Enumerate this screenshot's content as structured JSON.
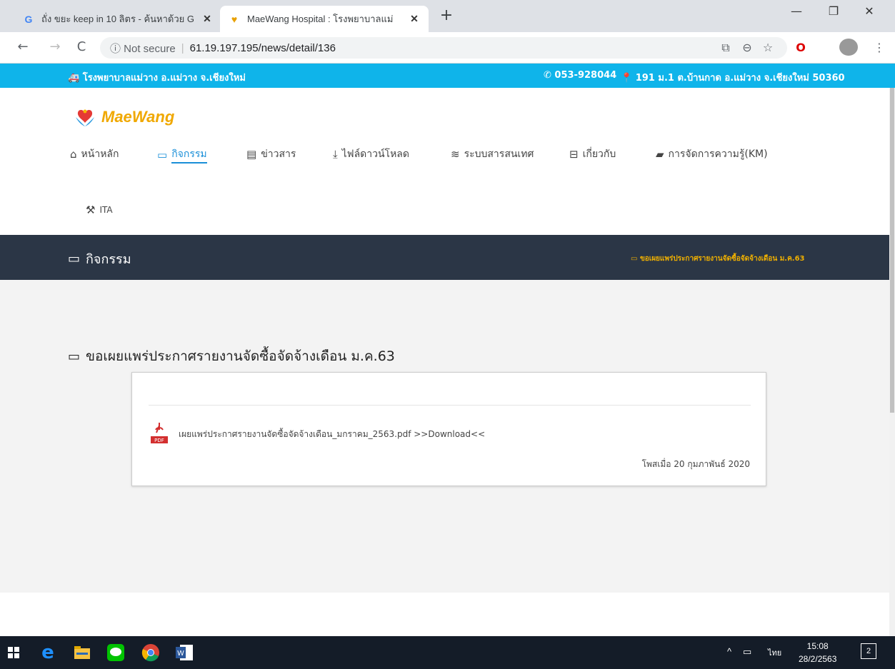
{
  "browser": {
    "tabs": [
      {
        "title": "ถั่ง ขยะ keep in 10 ลิตร - ค้นหาด้วย G",
        "icon": "google-icon"
      },
      {
        "title": "MaeWang Hospital : โรงพยาบาลแม่",
        "icon": "hospital-favicon"
      }
    ],
    "new_tab": "+",
    "window": {
      "minimize": "—",
      "restore": "❐",
      "close": "✕"
    },
    "nav": {
      "back": "←",
      "forward": "→",
      "reload": "C"
    },
    "security": "ⓘ Not secure",
    "url": "61.19.197.195/news/detail/136"
  },
  "topstrip": {
    "left": "🚑 โรงพยาบาลแม่วาง อ.แม่วาง จ.เชียงใหม่",
    "phone": "✆ 053-928044",
    "address": "📍 191 ม.1 ต.บ้านกาด อ.แม่วาง จ.เชียงใหม่ 50360"
  },
  "logo": {
    "text": "MaeWang"
  },
  "nav": [
    {
      "icon": "home-icon",
      "glyph": "🏠",
      "label": "หน้าหลัก"
    },
    {
      "icon": "monitor-icon",
      "glyph": "🖵",
      "label": "กิจกรรม"
    },
    {
      "icon": "newspaper-icon",
      "glyph": "📰",
      "label": "ข่าวสาร"
    },
    {
      "icon": "download-icon",
      "glyph": "⬇",
      "label": "ไฟล์ดาวน์โหลด"
    },
    {
      "icon": "database-icon",
      "glyph": "🗄",
      "label": "ระบบสารสนเทศ"
    },
    {
      "icon": "inbox-icon",
      "glyph": "🗂",
      "label": "เกี่ยวกับ"
    },
    {
      "icon": "book-icon",
      "glyph": "📘",
      "label": "การจัดการความรู้(KM)"
    },
    {
      "icon": "gavel-icon",
      "glyph": "🔨",
      "label": "ITA"
    }
  ],
  "section": {
    "title": "กิจกรรม",
    "breadcrumb": "ขอเผยแพร่ประกาศรายงานจัดซื้อจัดจ้างเดือน ม.ค.63"
  },
  "article": {
    "heading": "ขอเผยแพร่ประกาศรายงานจัดซื้อจัดจ้างเดือน ม.ค.63",
    "file": "เผยแพร่ประกาศรายงานจัดซื้อจัดจ้างเดือน_มกราคม_2563.pdf >>Download<<",
    "posted": "โพสเมื่อ 20 กุมภาพันธ์ 2020",
    "pdf_label": "PDF"
  },
  "taskbar": {
    "tray_arrow": "^",
    "lang": "ไทย",
    "time": "15:08",
    "date": "28/2/2563",
    "notifications": "2"
  }
}
